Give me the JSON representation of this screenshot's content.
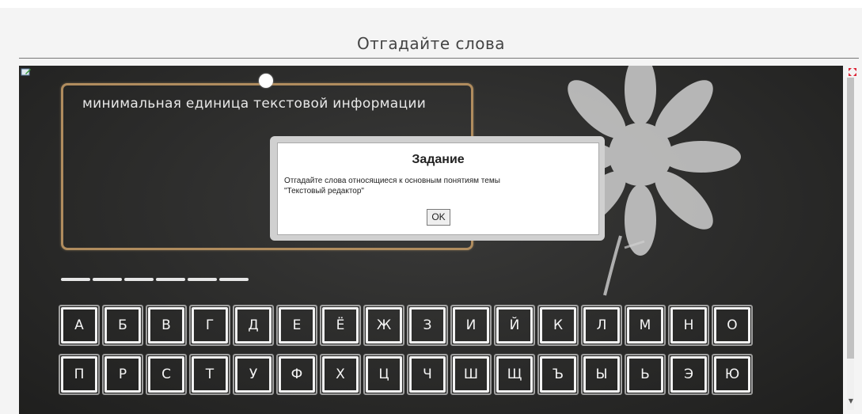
{
  "header": {
    "title": "Отгадайте слова"
  },
  "clue": {
    "text": "минимальная единица текстовой информации"
  },
  "answer": {
    "slots": 6
  },
  "keyboard": {
    "row1": [
      "А",
      "Б",
      "В",
      "Г",
      "Д",
      "Е",
      "Ё",
      "Ж",
      "З",
      "И",
      "Й",
      "К",
      "Л",
      "М",
      "Н",
      "О"
    ],
    "row2": [
      "П",
      "Р",
      "С",
      "Т",
      "У",
      "Ф",
      "Х",
      "Ц",
      "Ч",
      "Ш",
      "Щ",
      "Ъ",
      "Ы",
      "Ь",
      "Э",
      "Ю"
    ]
  },
  "dialog": {
    "title": "Задание",
    "text_line1": "Отгадайте слова относящиеся к основным понятиям темы",
    "text_line2": "\"Текстовый редактор\"",
    "ok_label": "OK"
  },
  "icons": {
    "edit": "edit-icon",
    "fullscreen": "fullscreen-icon",
    "flower": "chalk-flower-drawing"
  },
  "colors": {
    "board": "#2f2f2e",
    "frame": "#b08c5e",
    "chalk": "#f2f2f2"
  }
}
